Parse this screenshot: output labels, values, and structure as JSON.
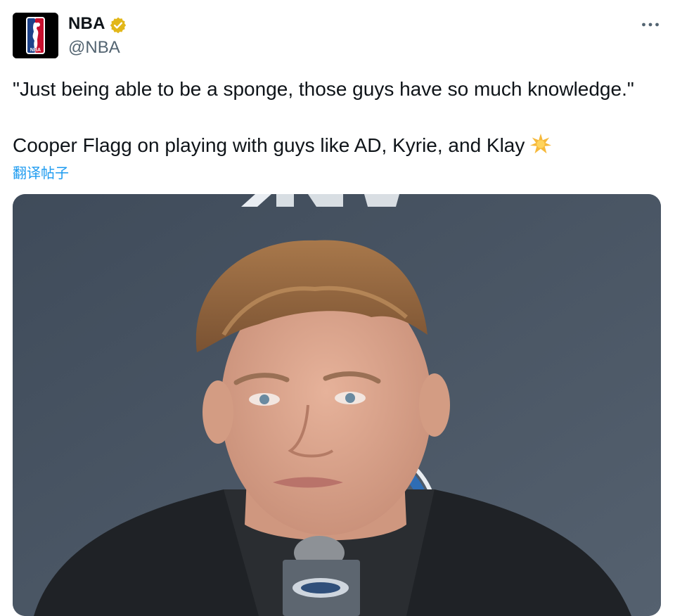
{
  "author": {
    "name": "NBA",
    "handle": "@NBA",
    "verified_icon": "verified-badge-icon",
    "avatar": "nba-logo"
  },
  "more_menu_icon": "more-horizontal-icon",
  "tweet": {
    "line1": "\"Just being able to be a sponge, those guys have so much knowledge.\"",
    "line2": "Cooper Flagg on playing with guys like AD, Kyrie, and Klay",
    "emoji": "sparkle-star-icon"
  },
  "translate_label": "翻译帖子",
  "media": {
    "description_icon": "press-conference-photo"
  },
  "colors": {
    "link": "#1d9bf0",
    "secondary_text": "#536471",
    "verified_gold": "#e2b719"
  }
}
